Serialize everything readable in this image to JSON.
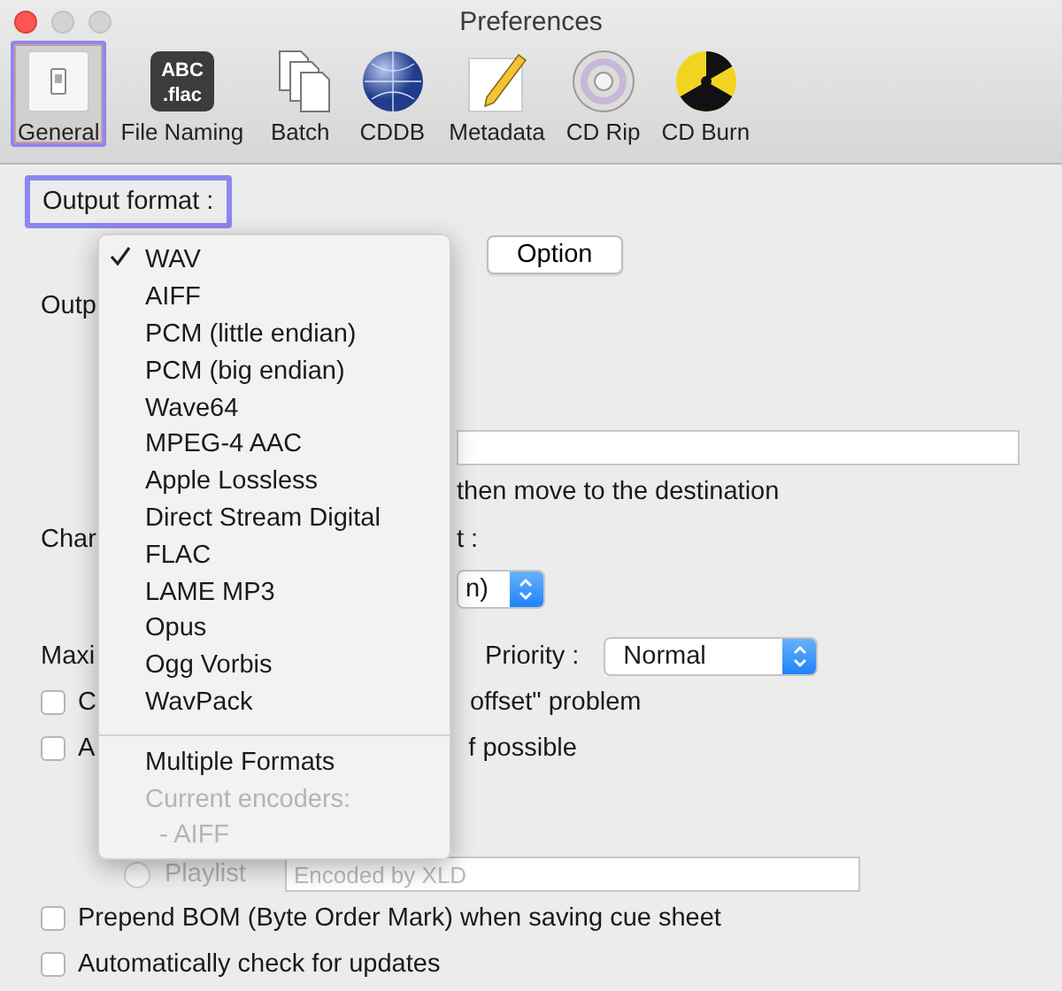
{
  "window": {
    "title": "Preferences"
  },
  "toolbar": [
    {
      "label": "General",
      "kind": "general",
      "selected": true,
      "highlighted": true
    },
    {
      "label": "File Naming",
      "kind": "naming",
      "selected": false,
      "highlighted": false,
      "icon_text": [
        "ABC",
        ".flac"
      ]
    },
    {
      "label": "Batch",
      "kind": "batch",
      "selected": false,
      "highlighted": false
    },
    {
      "label": "CDDB",
      "kind": "globe",
      "selected": false,
      "highlighted": false
    },
    {
      "label": "Metadata",
      "kind": "notepad",
      "selected": false,
      "highlighted": false
    },
    {
      "label": "CD Rip",
      "kind": "disc",
      "selected": false,
      "highlighted": false
    },
    {
      "label": "CD Burn",
      "kind": "burn",
      "selected": false,
      "highlighted": false
    }
  ],
  "output_format_label": {
    "text": "Output format :",
    "highlighted": true
  },
  "option_button": "Option",
  "output_label": "Outp",
  "move_text": "then move to the destination",
  "char_label": "Char",
  "char_suffix": "t :",
  "char_select": "n)",
  "max_label": "Maxi",
  "priority_label": "Priority :",
  "priority_select": "Normal",
  "checkboxes_partial": [
    {
      "left": "C",
      "right": "offset\" problem",
      "checked": false
    },
    {
      "left": "A",
      "right": "f possible",
      "checked": false
    }
  ],
  "playlist": {
    "label": "Playlist",
    "selected": false,
    "disabled": true,
    "placeholder": "Encoded by XLD"
  },
  "checkboxes": [
    {
      "label": "Prepend BOM (Byte Order Mark) when saving cue sheet",
      "checked": false
    },
    {
      "label": "Automatically check for updates",
      "checked": false
    }
  ],
  "format_menu": [
    {
      "kind": "item",
      "label": "WAV",
      "checked": true,
      "disabled": false
    },
    {
      "kind": "item",
      "label": "AIFF",
      "checked": false,
      "disabled": false
    },
    {
      "kind": "item",
      "label": "PCM (little endian)",
      "checked": false,
      "disabled": false
    },
    {
      "kind": "item",
      "label": "PCM (big endian)",
      "checked": false,
      "disabled": false
    },
    {
      "kind": "item",
      "label": "Wave64",
      "checked": false,
      "disabled": false
    },
    {
      "kind": "item",
      "label": "MPEG-4 AAC",
      "checked": false,
      "disabled": false
    },
    {
      "kind": "item",
      "label": "Apple Lossless",
      "checked": false,
      "disabled": false
    },
    {
      "kind": "item",
      "label": "Direct Stream Digital",
      "checked": false,
      "disabled": false
    },
    {
      "kind": "item",
      "label": "FLAC",
      "checked": false,
      "disabled": false
    },
    {
      "kind": "item",
      "label": "LAME MP3",
      "checked": false,
      "disabled": false
    },
    {
      "kind": "item",
      "label": "Opus",
      "checked": false,
      "disabled": false
    },
    {
      "kind": "item",
      "label": "Ogg Vorbis",
      "checked": false,
      "disabled": false
    },
    {
      "kind": "item",
      "label": "WavPack",
      "checked": false,
      "disabled": false
    },
    {
      "kind": "separator"
    },
    {
      "kind": "item",
      "label": "Multiple Formats",
      "checked": false,
      "disabled": false
    },
    {
      "kind": "item",
      "label": "Current encoders:",
      "checked": false,
      "disabled": true
    },
    {
      "kind": "item",
      "label": "  - AIFF",
      "checked": false,
      "disabled": true
    }
  ]
}
